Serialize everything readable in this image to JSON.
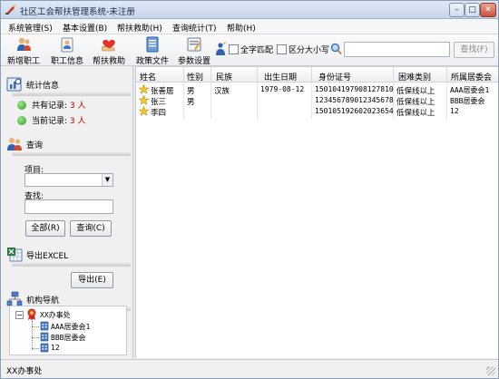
{
  "window": {
    "title": "社区工会帮扶管理系统-未注册",
    "min_label": "–",
    "max_label": "□",
    "close_label": "✕"
  },
  "menu": [
    {
      "label": "系统管理(S)"
    },
    {
      "label": "基本设置(B)"
    },
    {
      "label": "帮扶救助(H)"
    },
    {
      "label": "查询统计(T)"
    },
    {
      "label": "帮助(H)"
    }
  ],
  "toolbar": {
    "buttons": [
      {
        "label": "新增职工",
        "icon": "add-worker-icon"
      },
      {
        "label": "职工信息",
        "icon": "worker-info-icon"
      },
      {
        "label": "帮扶救助",
        "icon": "assistance-icon"
      },
      {
        "label": "政策文件",
        "icon": "policy-file-icon"
      },
      {
        "label": "参数设置",
        "icon": "settings-icon"
      }
    ],
    "whole_word_label": "全字匹配",
    "case_sensitive_label": "区分大小写",
    "search_value": "",
    "find_label": "查找(F)"
  },
  "stats": {
    "title": "统计信息",
    "total_label": "共有记录:",
    "total_value": "3 人",
    "current_label": "当前记录:",
    "current_value": "3 人"
  },
  "query": {
    "title": "查询",
    "item_label": "项目:",
    "find_label": "查找:",
    "select_value": "",
    "find_value": "",
    "all_button": "全部(R)",
    "query_button": "查询(C)"
  },
  "export": {
    "title": "导出EXCEL",
    "button": "导出(E)"
  },
  "org_nav": {
    "title": "机构导航",
    "root": "XX办事处",
    "children": [
      "AAA居委会1",
      "BBB居委会",
      "12"
    ]
  },
  "table": {
    "columns": [
      "姓名",
      "性别",
      "民族",
      "出生日期",
      "身份证号",
      "困难类别",
      "所属居委会"
    ],
    "rows": [
      {
        "name": "张善居",
        "gender": "男",
        "ethnicity": "汉族",
        "birth": "1979-08-12",
        "id_no": "150104197908127810",
        "category": "低保线以上",
        "committee": "AAA居委会1"
      },
      {
        "name": "张三",
        "gender": "男",
        "ethnicity": "",
        "birth": "",
        "id_no": "123456789012345678",
        "category": "低保线以上",
        "committee": "BBB居委会"
      },
      {
        "name": "李四",
        "gender": "",
        "ethnicity": "",
        "birth": "",
        "id_no": "150105192602023654",
        "category": "低保线以上",
        "committee": "12"
      }
    ]
  },
  "status": {
    "text": "XX办事处"
  },
  "colors": {
    "count_red": "#c00000",
    "title_gradient_top": "#dfe9f5",
    "close_red": "#c8533c"
  }
}
